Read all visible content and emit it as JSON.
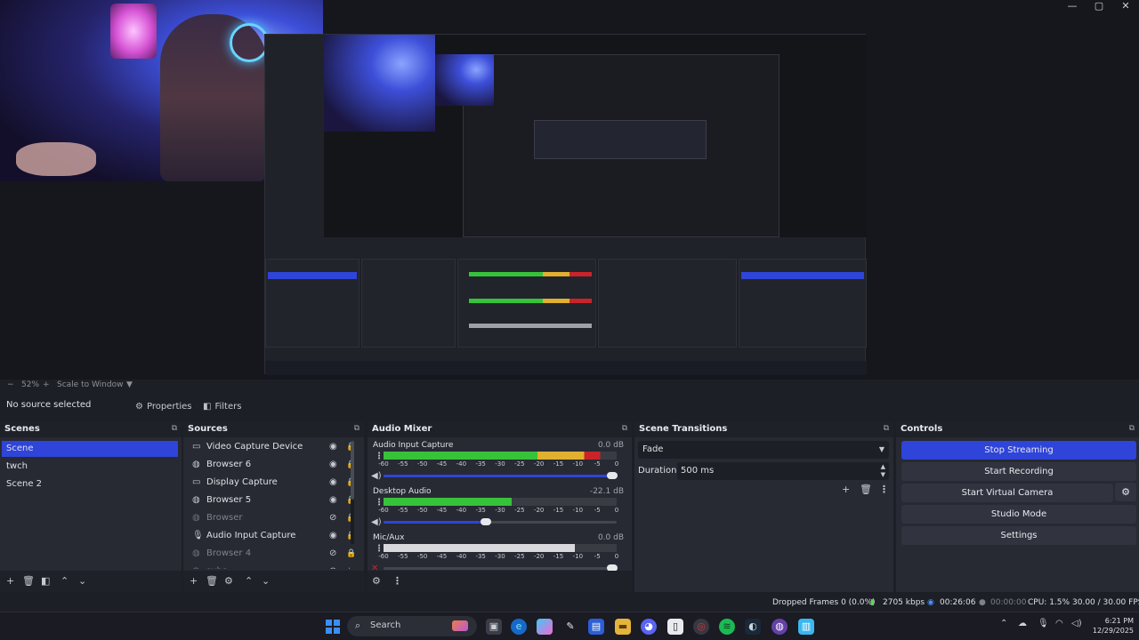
{
  "window": {
    "controls": [
      "—",
      "▢",
      "✕"
    ]
  },
  "preview": {
    "zoom": "52%",
    "scale_mode": "Scale to Window"
  },
  "toolbar": {
    "no_source": "No source selected",
    "properties_label": "Properties",
    "filters_label": "Filters"
  },
  "scenes": {
    "title": "Scenes",
    "items": [
      {
        "label": "Scene",
        "active": true
      },
      {
        "label": "twch",
        "active": false
      },
      {
        "label": "Scene 2",
        "active": false
      }
    ]
  },
  "sources": {
    "title": "Sources",
    "items": [
      {
        "label": "Video Capture Device",
        "icon": "camera-icon",
        "visible": true
      },
      {
        "label": "Browser 6",
        "icon": "globe-icon",
        "visible": true
      },
      {
        "label": "Display Capture",
        "icon": "monitor-icon",
        "visible": true
      },
      {
        "label": "Browser 5",
        "icon": "globe-icon",
        "visible": true
      },
      {
        "label": "Browser",
        "icon": "globe-icon",
        "visible": false
      },
      {
        "label": "Audio Input Capture",
        "icon": "microphone-icon",
        "visible": true
      },
      {
        "label": "Browser 4",
        "icon": "globe-icon",
        "visible": false
      },
      {
        "label": "subs",
        "icon": "globe-icon",
        "visible": false
      }
    ]
  },
  "audio_mixer": {
    "title": "Audio Mixer",
    "scale": [
      "-60",
      "-55",
      "-50",
      "-45",
      "-40",
      "-35",
      "-30",
      "-25",
      "-20",
      "-15",
      "-10",
      "-5",
      "0"
    ],
    "channels": [
      {
        "name": "Audio Input Capture",
        "db": "0.0 dB",
        "level": 0.93,
        "volume": 0.98
      },
      {
        "name": "Desktop Audio",
        "db": "-22.1 dB",
        "level": 0.55,
        "volume": 0.44
      },
      {
        "name": "Mic/Aux",
        "db": "0.0 dB",
        "level": 0.82,
        "volume": 0.98
      }
    ]
  },
  "scene_transitions": {
    "title": "Scene Transitions",
    "transition": "Fade",
    "duration_label": "Duration",
    "duration_value": "500 ms"
  },
  "controls": {
    "title": "Controls",
    "buttons": [
      {
        "label": "Stop Streaming",
        "active": true
      },
      {
        "label": "Start Recording",
        "active": false
      },
      {
        "label": "Start Virtual Camera",
        "active": false
      },
      {
        "label": "Studio Mode",
        "active": false
      },
      {
        "label": "Settings",
        "active": false
      }
    ]
  },
  "status": {
    "dropped_frames": "Dropped Frames 0 (0.0%)",
    "bitrate": "2705 kbps",
    "stream_time": "00:26:06",
    "record_time": "00:00:00",
    "cpu": "CPU: 1.5%",
    "fps": "30.00 / 30.00 FPS"
  },
  "taskbar": {
    "search_label": "Search",
    "time": "6:21 PM",
    "date": "12/29/2025"
  },
  "colors": {
    "accent": "#2f44d8",
    "dock_bg": "#272a33",
    "meter_green": "#36c33a",
    "meter_yellow": "#e0b02e",
    "meter_red": "#c9242a"
  }
}
